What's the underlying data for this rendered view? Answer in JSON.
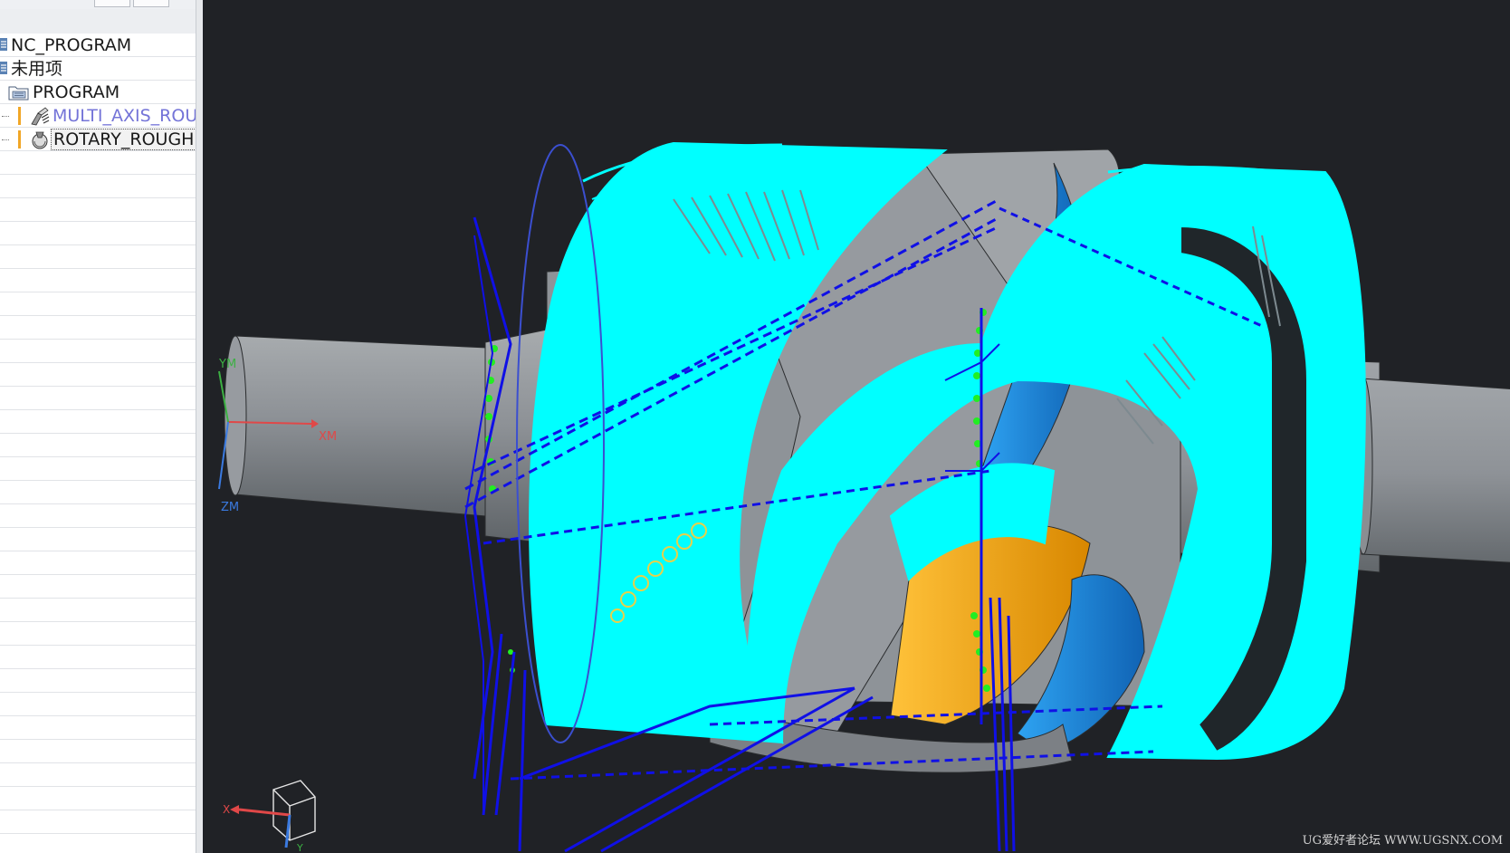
{
  "navigator": {
    "items": [
      {
        "label": "NC_PROGRAM"
      },
      {
        "label": "未用项"
      },
      {
        "label": "PROGRAM"
      },
      {
        "label": "MULTI_AXIS_ROU..."
      },
      {
        "label": "ROTARY_ROUGHI"
      }
    ]
  },
  "viewport": {
    "wcs": {
      "x_label": "XM",
      "y_label": "YM",
      "z_label": "ZM"
    },
    "triad": {
      "x_label": "X",
      "y_label": "Y"
    },
    "watermark": "UG爱好者论坛 WWW.UGSNX.COM"
  },
  "colors": {
    "toolpath_cut": "#00ffff",
    "toolpath_rapid": "#1010e6",
    "toolpath_engage": "#22ee22",
    "part_gray": "#8f9499",
    "part_orange": "#f0a000",
    "part_blue": "#1e88d8",
    "background": "#202226"
  }
}
